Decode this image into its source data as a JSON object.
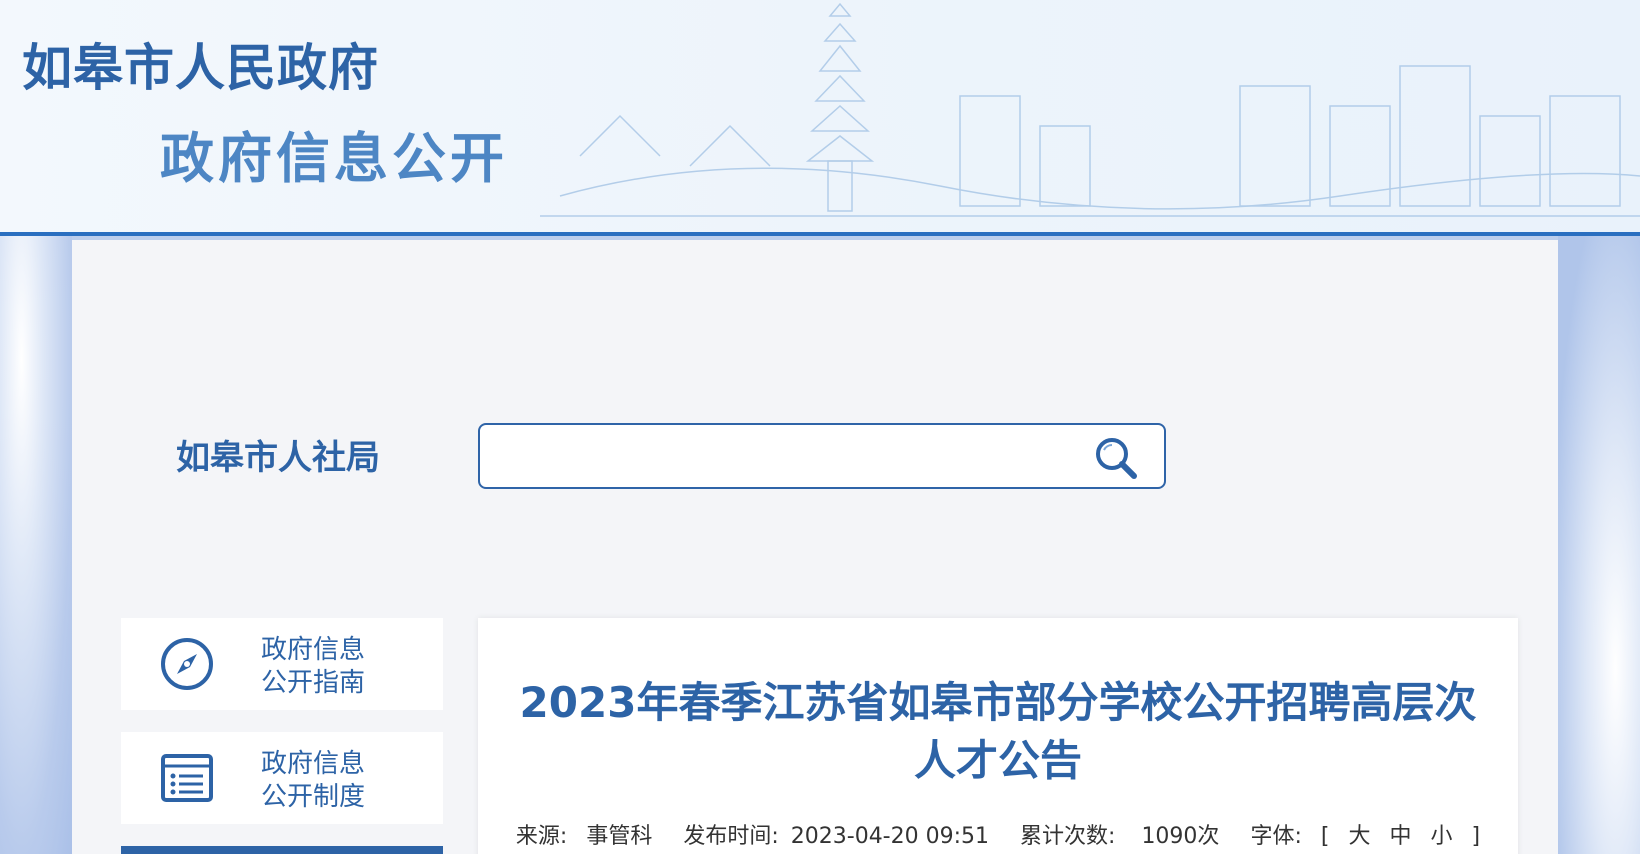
{
  "header": {
    "site_title": "如皋市人民政府",
    "site_subtitle": "政府信息公开"
  },
  "department": {
    "name": "如皋市人社局"
  },
  "search": {
    "placeholder": "",
    "value": ""
  },
  "sidebar": {
    "items": [
      {
        "icon": "compass-icon",
        "label_line1": "政府信息",
        "label_line2": "公开指南"
      },
      {
        "icon": "list-document-icon",
        "label_line1": "政府信息",
        "label_line2": "公开制度"
      }
    ]
  },
  "article": {
    "title": "2023年春季江苏省如皋市部分学校公开招聘高层次人才公告",
    "source_label": "来源:",
    "source_value": "事管科",
    "publish_label": "发布时间:",
    "publish_value": "2023-04-20 09:51",
    "views_label": "累计次数:",
    "views_value": "1090次",
    "font_label": "字体:",
    "font_open": "[",
    "font_large": "大",
    "font_medium": "中",
    "font_small": "小",
    "font_close": "]"
  },
  "colors": {
    "brand_blue": "#2d63a6",
    "header_border": "#2a6fc0"
  }
}
